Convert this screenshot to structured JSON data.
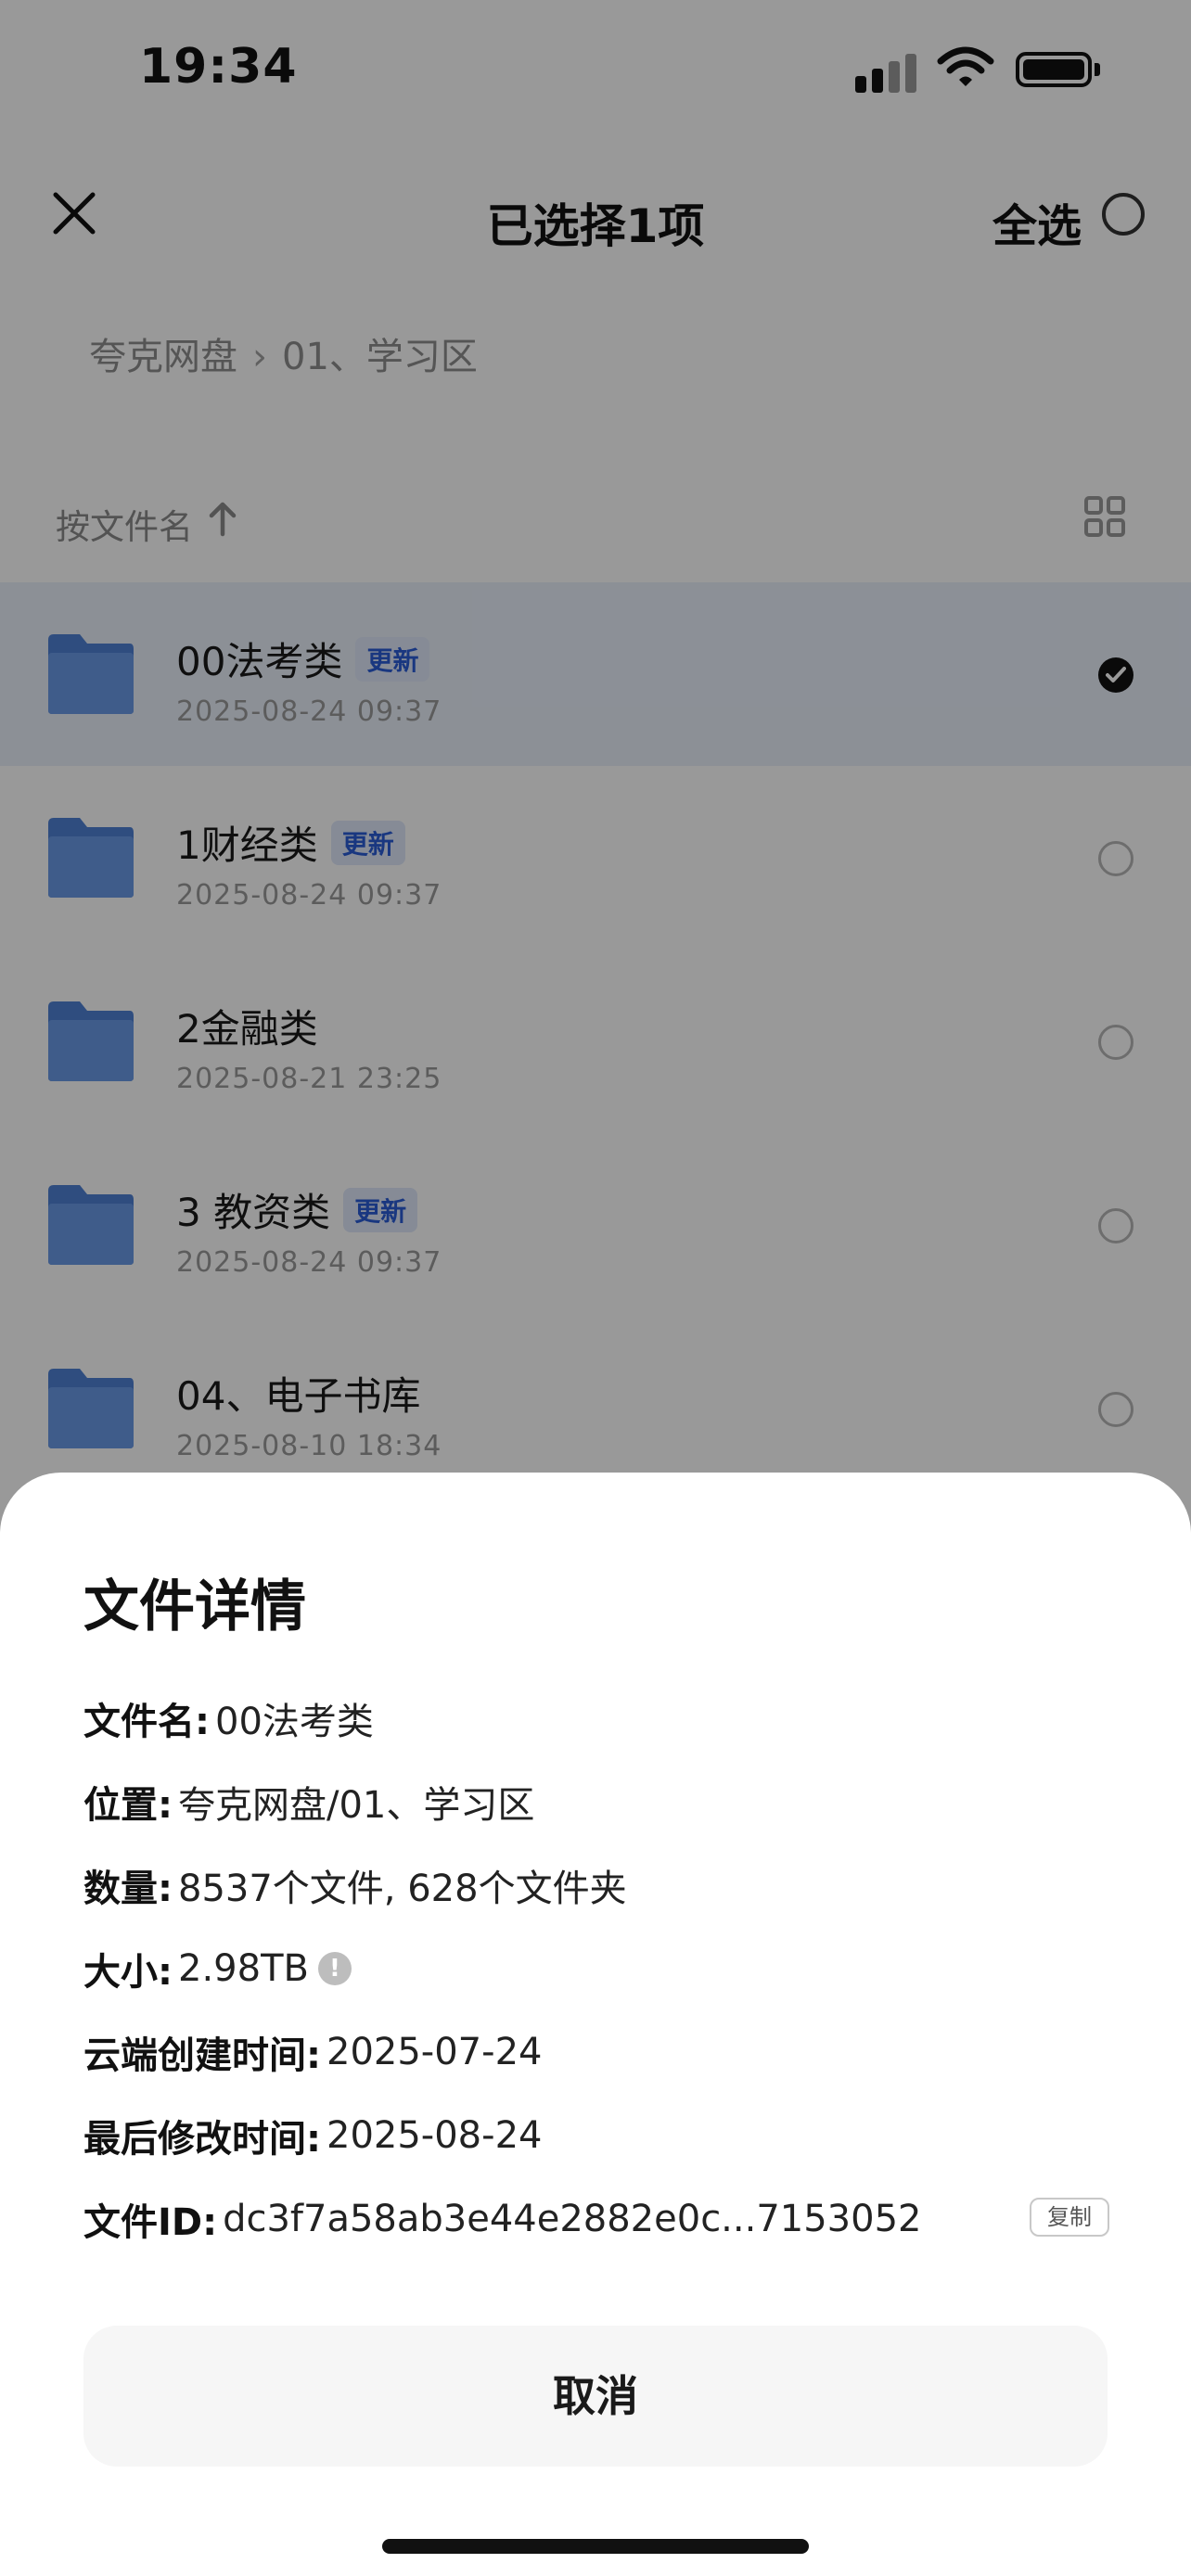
{
  "status_bar": {
    "time": "19:34"
  },
  "nav": {
    "title": "已选择1项",
    "select_all": "全选"
  },
  "breadcrumb": {
    "root": "夸克网盘",
    "sep": "›",
    "current": "01、学习区"
  },
  "sort": {
    "label": "按文件名"
  },
  "files": [
    {
      "name": "00法考类",
      "badge": "更新",
      "date": "2025-08-24 09:37",
      "selected": true
    },
    {
      "name": "1财经类",
      "badge": "更新",
      "date": "2025-08-24 09:37",
      "selected": false
    },
    {
      "name": "2金融类",
      "badge": "",
      "date": "2025-08-21 23:25",
      "selected": false
    },
    {
      "name": "3 教资类",
      "badge": "更新",
      "date": "2025-08-24 09:37",
      "selected": false
    },
    {
      "name": "04、电子书库",
      "badge": "",
      "date": "2025-08-10 18:34",
      "selected": false
    }
  ],
  "sheet": {
    "title": "文件详情",
    "details": {
      "name_key": "文件名:",
      "name_val": "00法考类",
      "location_key": "位置:",
      "location_val": "夸克网盘/01、学习区",
      "count_key": "数量:",
      "count_val": "8537个文件, 628个文件夹",
      "size_key": "大小:",
      "size_val": "2.98TB",
      "created_key": "云端创建时间:",
      "created_val": "2025-07-24",
      "modified_key": "最后修改时间:",
      "modified_val": "2025-08-24",
      "id_key": "文件ID:",
      "id_val": "dc3f7a58ab3e44e2882e0c...7153052"
    },
    "copy_label": "复制",
    "cancel_label": "取消"
  },
  "colors": {
    "accent": "#2b5cd6",
    "folder": "#5b8bd9",
    "overlay": "rgba(0,0,0,0.40)"
  },
  "icons": [
    "close-icon",
    "select-all-radio",
    "sort-up-arrow-icon",
    "grid-view-icon",
    "folder-icon",
    "checkmark-icon",
    "info-icon",
    "signal-icon",
    "wifi-icon",
    "battery-icon"
  ]
}
